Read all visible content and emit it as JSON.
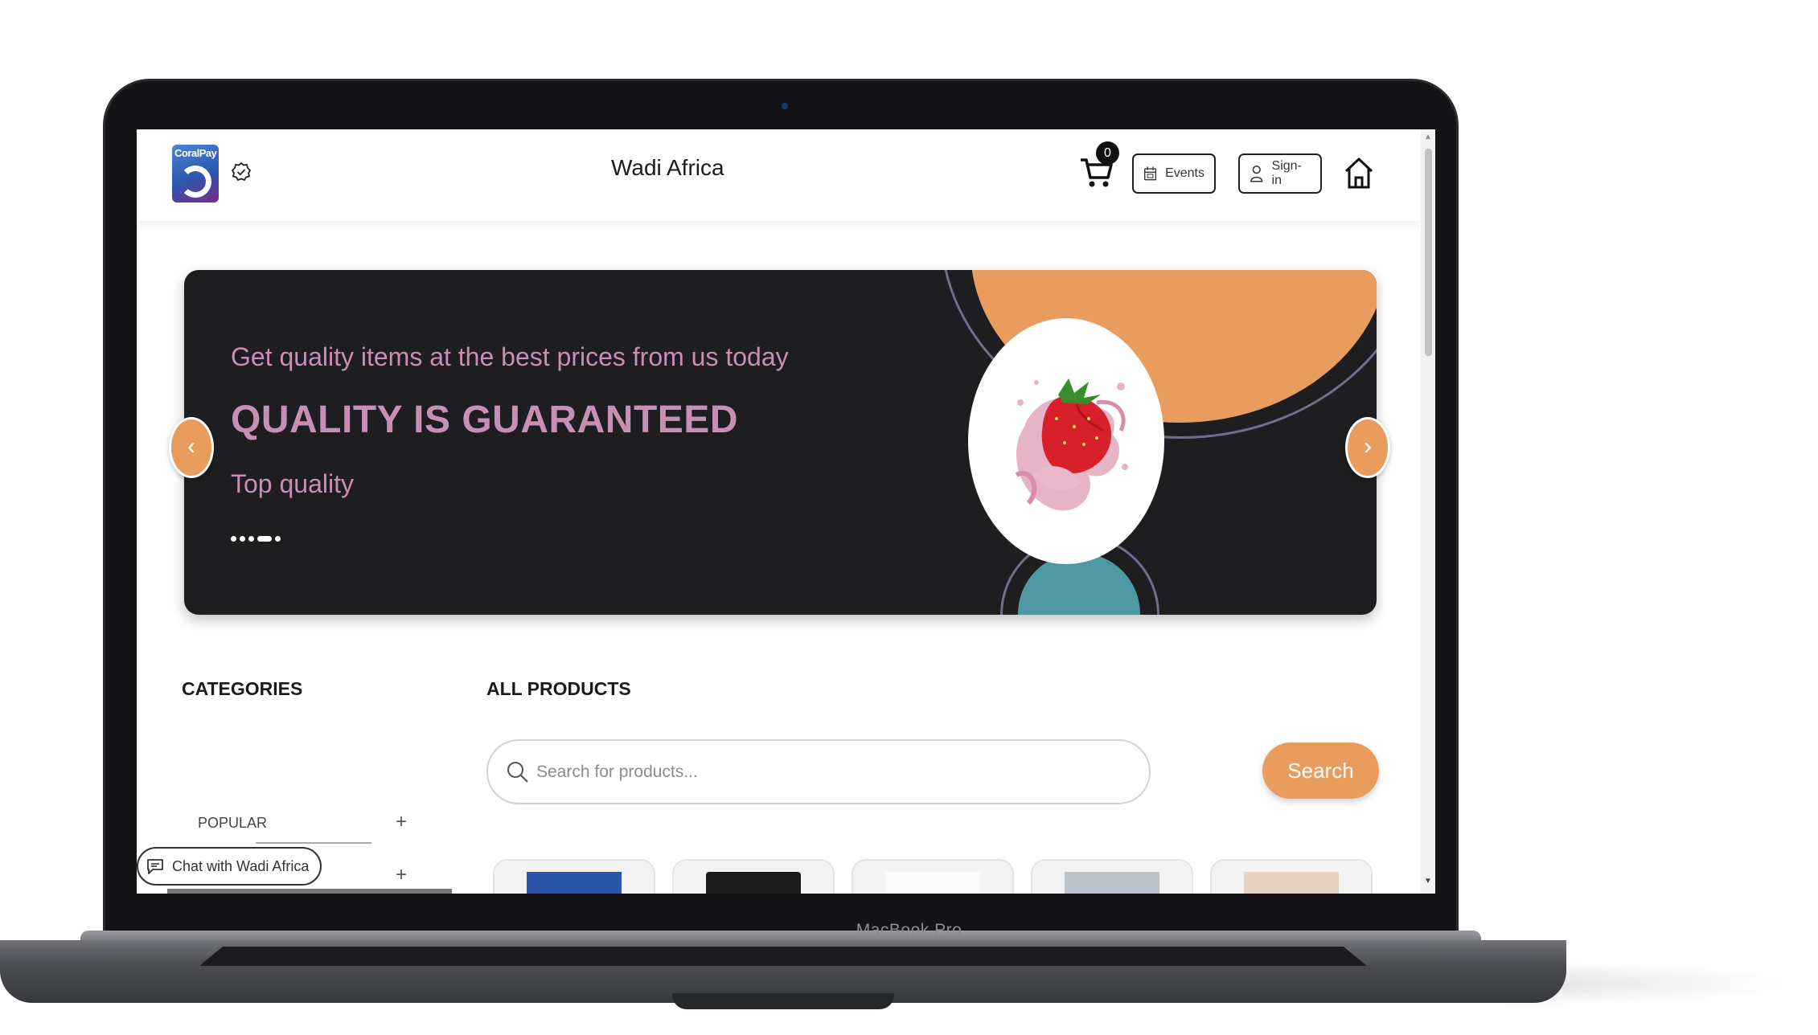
{
  "device": {
    "model_label": "MacBook Pro"
  },
  "header": {
    "logo_text": "CoralPay",
    "site_title": "Wadi Africa",
    "cart_count": "0",
    "events_label": "Events",
    "signin_label": "Sign-in"
  },
  "hero": {
    "subtitle": "Get quality items at the best prices from us today",
    "title": "QUALITY IS GUARANTEED",
    "tagline": "Top quality",
    "slide_count": 5,
    "active_slide": 4,
    "prev_arrow": "‹",
    "next_arrow": "›"
  },
  "categories": {
    "heading": "CATEGORIES",
    "items": [
      {
        "label": "POPULAR",
        "toggle": "+"
      },
      {
        "label": "",
        "toggle": "+"
      }
    ]
  },
  "products": {
    "heading": "ALL PRODUCTS",
    "search_placeholder": "Search for products...",
    "search_button": "Search"
  },
  "chat": {
    "label": "Chat with Wadi Africa"
  },
  "colors": {
    "accent": "#e89d5e",
    "hero_bg": "#1e1d1f",
    "hero_text": "#c78fb4",
    "teal": "#4e98a3"
  },
  "icons": [
    "verified-badge-icon",
    "cart-icon",
    "calendar-icon",
    "user-icon",
    "home-icon",
    "search-icon",
    "chat-icon",
    "chevron-left-icon",
    "chevron-right-icon",
    "plus-icon"
  ]
}
